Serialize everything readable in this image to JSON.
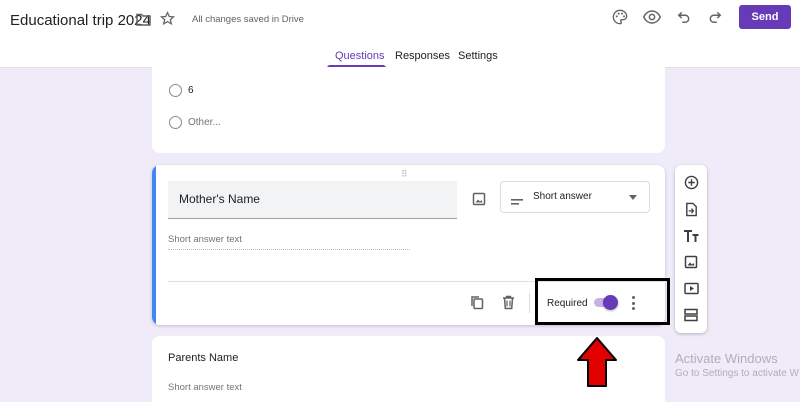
{
  "header": {
    "title": "Educational trip 2024",
    "saved_status": "All changes saved in Drive",
    "send_label": "Send",
    "icons": [
      "folder-icon",
      "star-icon",
      "palette-icon",
      "eye-icon",
      "undo-icon",
      "redo-icon"
    ]
  },
  "tabs": [
    {
      "label": "Questions",
      "active": true
    },
    {
      "label": "Responses",
      "active": false
    },
    {
      "label": "Settings",
      "active": false
    }
  ],
  "previous_question": {
    "options": [
      "6",
      "Other..."
    ]
  },
  "active_question": {
    "title": "Mother's Name",
    "type": "Short answer",
    "answer_placeholder": "Short answer text",
    "required_label": "Required",
    "required": true
  },
  "next_question": {
    "title": "Parents Name",
    "answer_placeholder": "Short answer text"
  },
  "side_toolbar": [
    "add-question-icon",
    "import-questions-icon",
    "add-title-icon",
    "add-image-icon",
    "add-video-icon",
    "add-section-icon"
  ],
  "watermark": {
    "line1": "Activate Windows",
    "line2": "Go to Settings to activate W"
  },
  "colors": {
    "accent": "#673ab7",
    "background": "#f0ebf8",
    "active_card_bar": "#4285f4",
    "annotation_arrow": "#e00000"
  }
}
